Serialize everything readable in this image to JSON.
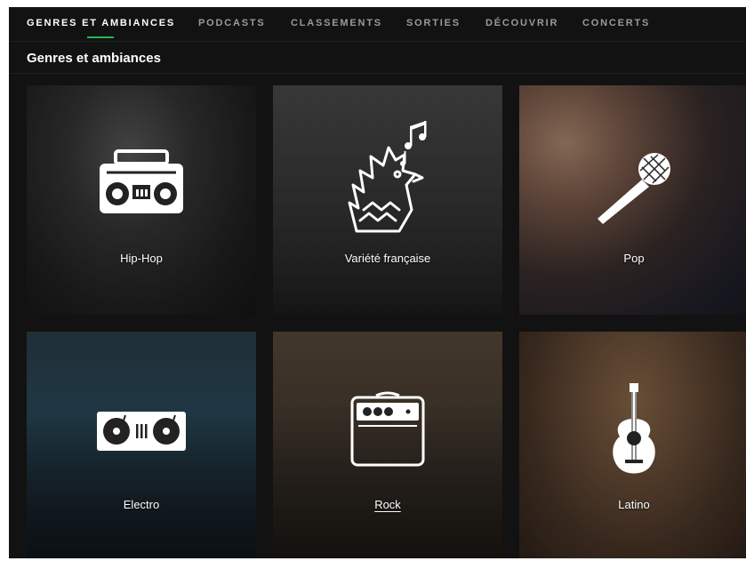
{
  "nav": {
    "tabs": [
      {
        "label": "GENRES ET AMBIANCES",
        "active": true
      },
      {
        "label": "PODCASTS",
        "active": false
      },
      {
        "label": "CLASSEMENTS",
        "active": false
      },
      {
        "label": "SORTIES",
        "active": false
      },
      {
        "label": "DÉCOUVRIR",
        "active": false
      },
      {
        "label": "CONCERTS",
        "active": false
      }
    ]
  },
  "section": {
    "title": "Genres et ambiances"
  },
  "tiles": [
    {
      "label": "Hip-Hop",
      "icon": "boombox-icon"
    },
    {
      "label": "Variété française",
      "icon": "rooster-icon"
    },
    {
      "label": "Pop",
      "icon": "microphone-icon"
    },
    {
      "label": "Electro",
      "icon": "turntables-icon"
    },
    {
      "label": "Rock",
      "icon": "amplifier-icon"
    },
    {
      "label": "Latino",
      "icon": "guitar-icon"
    }
  ],
  "colors": {
    "accent": "#1db954",
    "background": "#121212"
  }
}
